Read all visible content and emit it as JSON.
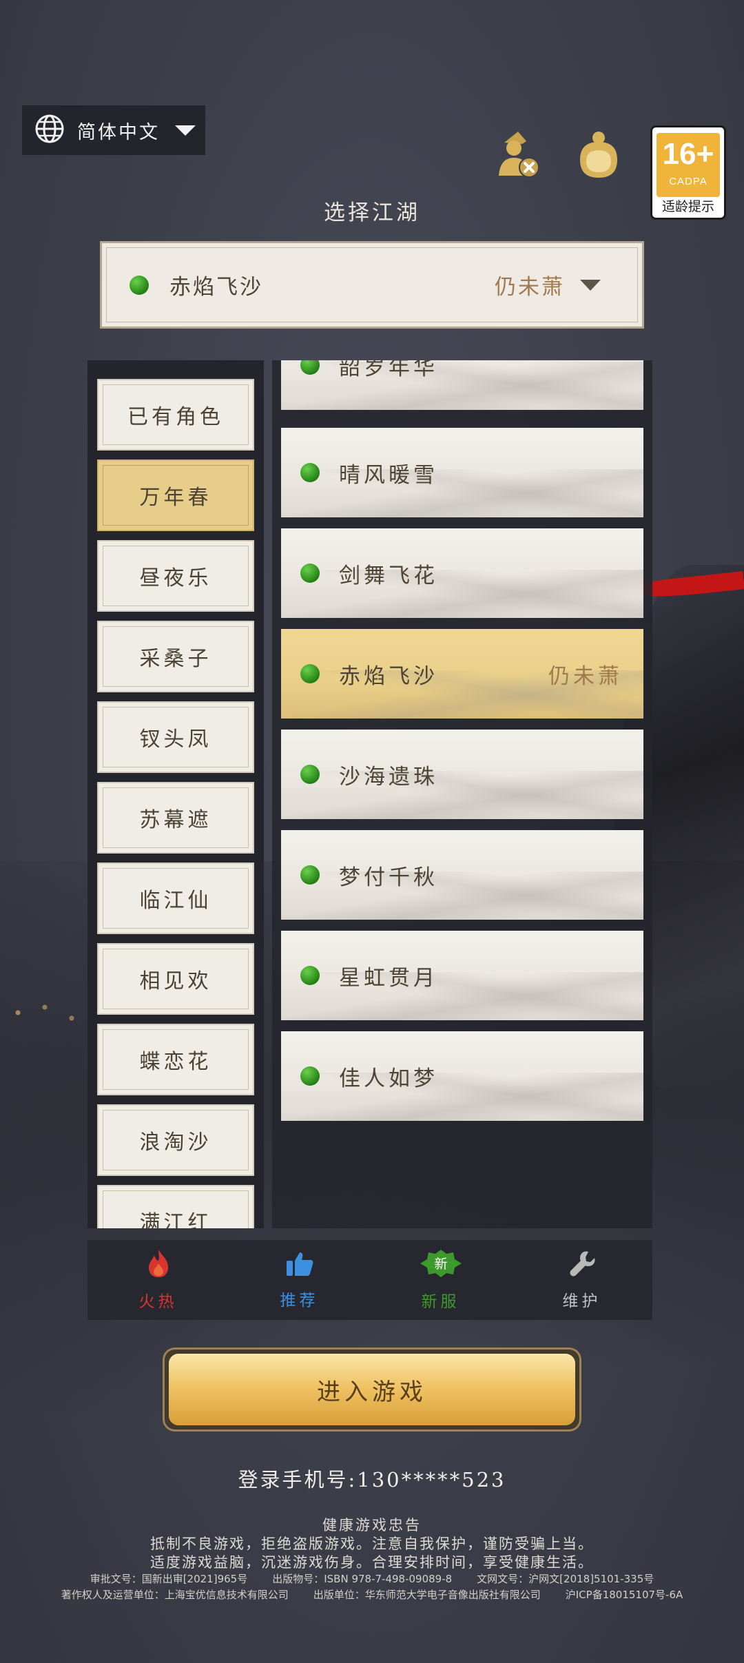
{
  "language": {
    "label": "简体中文",
    "icon": "globe-icon"
  },
  "top_icons": {
    "logout": "user-cross-icon",
    "avatar": "character-avatar-icon"
  },
  "age_rating": {
    "rating": "16+",
    "org": "CADPA",
    "tip": "适龄提示"
  },
  "title": "选择江湖",
  "selected_server": {
    "name": "赤焰飞沙",
    "player": "仍未萧",
    "status_color": "#2e9a1f"
  },
  "categories": [
    {
      "label": "已有角色"
    },
    {
      "label": "万年春"
    },
    {
      "label": "昼夜乐"
    },
    {
      "label": "采桑子"
    },
    {
      "label": "钗头凤"
    },
    {
      "label": "苏幕遮"
    },
    {
      "label": "临江仙"
    },
    {
      "label": "相见欢"
    },
    {
      "label": "蝶恋花"
    },
    {
      "label": "浪淘沙"
    },
    {
      "label": "满江红"
    }
  ],
  "active_category": "万年春",
  "servers": [
    {
      "name": "韶岁年华",
      "player": ""
    },
    {
      "name": "晴风暖雪",
      "player": ""
    },
    {
      "name": "剑舞飞花",
      "player": ""
    },
    {
      "name": "赤焰飞沙",
      "player": "仍未萧"
    },
    {
      "name": "沙海遗珠",
      "player": ""
    },
    {
      "name": "梦付千秋",
      "player": ""
    },
    {
      "name": "星虹贯月",
      "player": ""
    },
    {
      "name": "佳人如梦",
      "player": ""
    }
  ],
  "tabs": [
    {
      "label": "火热",
      "icon": "flame-icon",
      "color": "#d8352f"
    },
    {
      "label": "推荐",
      "icon": "thumbs-up-icon",
      "color": "#3d8fe0"
    },
    {
      "label": "新服",
      "icon": "new-badge-icon",
      "color": "#3c9a2c"
    },
    {
      "label": "维护",
      "icon": "wrench-icon",
      "color": "#c2c2c2"
    }
  ],
  "enter_button": "进入游戏",
  "phone": {
    "label": "登录手机号:",
    "value": "130*****523"
  },
  "notice": {
    "title": "健康游戏忠告",
    "line1": "抵制不良游戏，拒绝盗版游戏。注意自我保护，谨防受骗上当。",
    "line2": "适度游戏益脑，沉迷游戏伤身。合理安排时间，享受健康生活。"
  },
  "footer": {
    "approval": "审批文号：国新出审[2021]965号",
    "publication": "出版物号：ISBN 978-7-498-09089-8",
    "culture": "文网文号：沪网文[2018]5101-335号",
    "copyright": "著作权人及运营单位：上海宝优信息技术有限公司",
    "publisher": "出版单位：华东师范大学电子音像出版社有限公司",
    "icp": "沪ICP备18015107号-6A"
  }
}
